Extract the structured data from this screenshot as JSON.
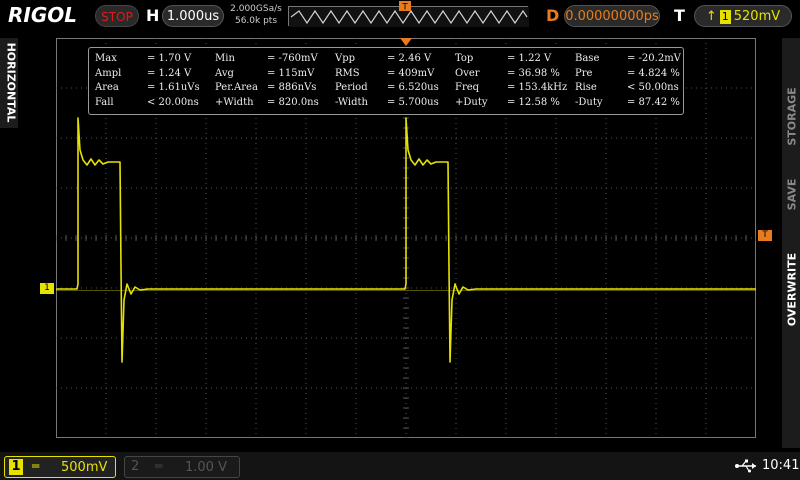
{
  "topbar": {
    "logo": "RIGOL",
    "status": "STOP",
    "h_label": "H",
    "timebase": "1.000us",
    "sample_rate": "2.000GSa/s",
    "memory_depth": "56.0k pts",
    "d_label": "D",
    "delay": "0.00000000ps",
    "t_label": "T",
    "trigger_channel": "1",
    "trigger_level": "520mV"
  },
  "side": {
    "left_tab": "HORIZONTAL",
    "right_tabs": [
      "STORAGE",
      "SAVE",
      "OVERWRITE"
    ]
  },
  "markers": {
    "ch1": "1",
    "trigger": "T"
  },
  "measurements": [
    [
      {
        "name": "Max",
        "value": "= 1.70 V"
      },
      {
        "name": "Min",
        "value": "= -760mV"
      },
      {
        "name": "Vpp",
        "value": "= 2.46 V"
      },
      {
        "name": "Top",
        "value": "= 1.22 V"
      },
      {
        "name": "Base",
        "value": "= -20.2mV"
      }
    ],
    [
      {
        "name": "Ampl",
        "value": "= 1.24 V"
      },
      {
        "name": "Avg",
        "value": "= 115mV"
      },
      {
        "name": "RMS",
        "value": "= 409mV"
      },
      {
        "name": "Over",
        "value": "= 36.98 %"
      },
      {
        "name": "Pre",
        "value": "= 4.824 %"
      }
    ],
    [
      {
        "name": "Area",
        "value": "= 1.61uVs"
      },
      {
        "name": "Per.Area",
        "value": "= 886nVs"
      },
      {
        "name": "Period",
        "value": "= 6.520us"
      },
      {
        "name": "Freq",
        "value": "= 153.4kHz"
      },
      {
        "name": "Rise",
        "value": "< 50.00ns"
      }
    ],
    [
      {
        "name": "Fall",
        "value": "< 20.00ns"
      },
      {
        "name": "+Width",
        "value": "= 820.0ns"
      },
      {
        "name": "-Width",
        "value": "= 5.700us"
      },
      {
        "name": "+Duty",
        "value": "= 12.58 %"
      },
      {
        "name": "-Duty",
        "value": "= 87.42 %"
      }
    ]
  ],
  "bottombar": {
    "ch1_number": "1",
    "ch1_coupling": "═",
    "ch1_scale": "500mV",
    "ch2_number": "2",
    "ch2_coupling": "═",
    "ch2_scale": "1.00 V",
    "clock": "10:41"
  },
  "colors": {
    "ch1": "#e6e200",
    "trigger": "#e87c1c",
    "grid": "#555555"
  }
}
